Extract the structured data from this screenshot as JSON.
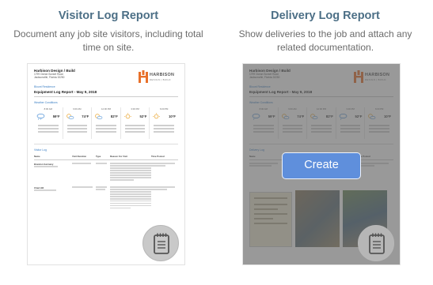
{
  "visitor_card": {
    "title": "Visitor Log Report",
    "description": "Document any job site visitors, including total time on site."
  },
  "delivery_card": {
    "title": "Delivery Log Report",
    "description": "Show deliveries to the job and attach any related documentation.",
    "create_label": "Create"
  },
  "preview": {
    "company": "Harbison Design / Build",
    "address_line1": "1799 Ocean Sunset Road",
    "address_line2": "Jacksonville, Florida 32250",
    "logo_name": "HARBISON",
    "logo_sub": "DESIGN | BUILD",
    "project": "Blount Residence",
    "report_title": "Equipment Log Report - May 9, 2018",
    "weather_title": "Weather Conditions",
    "weather": [
      {
        "time": "8:00 AM",
        "temp": "59°F",
        "icon": "cloud-rain-icon",
        "cond": "Rain"
      },
      {
        "time": "9:00 AM",
        "temp": "74°F",
        "icon": "sun-cloud-icon",
        "cond": "Clear Sky"
      },
      {
        "time": "12:00 PM",
        "temp": "82°F",
        "icon": "sun-cloud-icon",
        "cond": "Clear Sky"
      },
      {
        "time": "3:00 PM",
        "temp": "52°F",
        "icon": "sun-icon",
        "cond": "Clear Sky"
      },
      {
        "time": "6:00 PM",
        "temp": "10°F",
        "icon": "sun-icon",
        "cond": "Clear Sky"
      }
    ],
    "delivery_weather_icons": [
      "cloud-rain-icon",
      "sun-cloud-icon",
      "sun-cloud-icon",
      "cloud-rain-icon",
      "sun-cloud-icon"
    ],
    "visitor_log_title": "Visitor Log",
    "delivery_log_title": "Delivery Log",
    "visitor_columns": [
      "Name",
      "Visit Duration",
      "Type",
      "Reason For Visit",
      "Time Posted"
    ],
    "delivery_columns": [
      "Name",
      "Delivery Details",
      "Time Posted"
    ],
    "visitor_rows": [
      {
        "name": "Brandon Garmany"
      },
      {
        "name": "Chad Hill"
      }
    ]
  },
  "colors": {
    "title": "#4c6f86",
    "create_button": "#5f8fdc",
    "overlay": "#5a5a5a",
    "logo_orange": "#e8702a"
  }
}
